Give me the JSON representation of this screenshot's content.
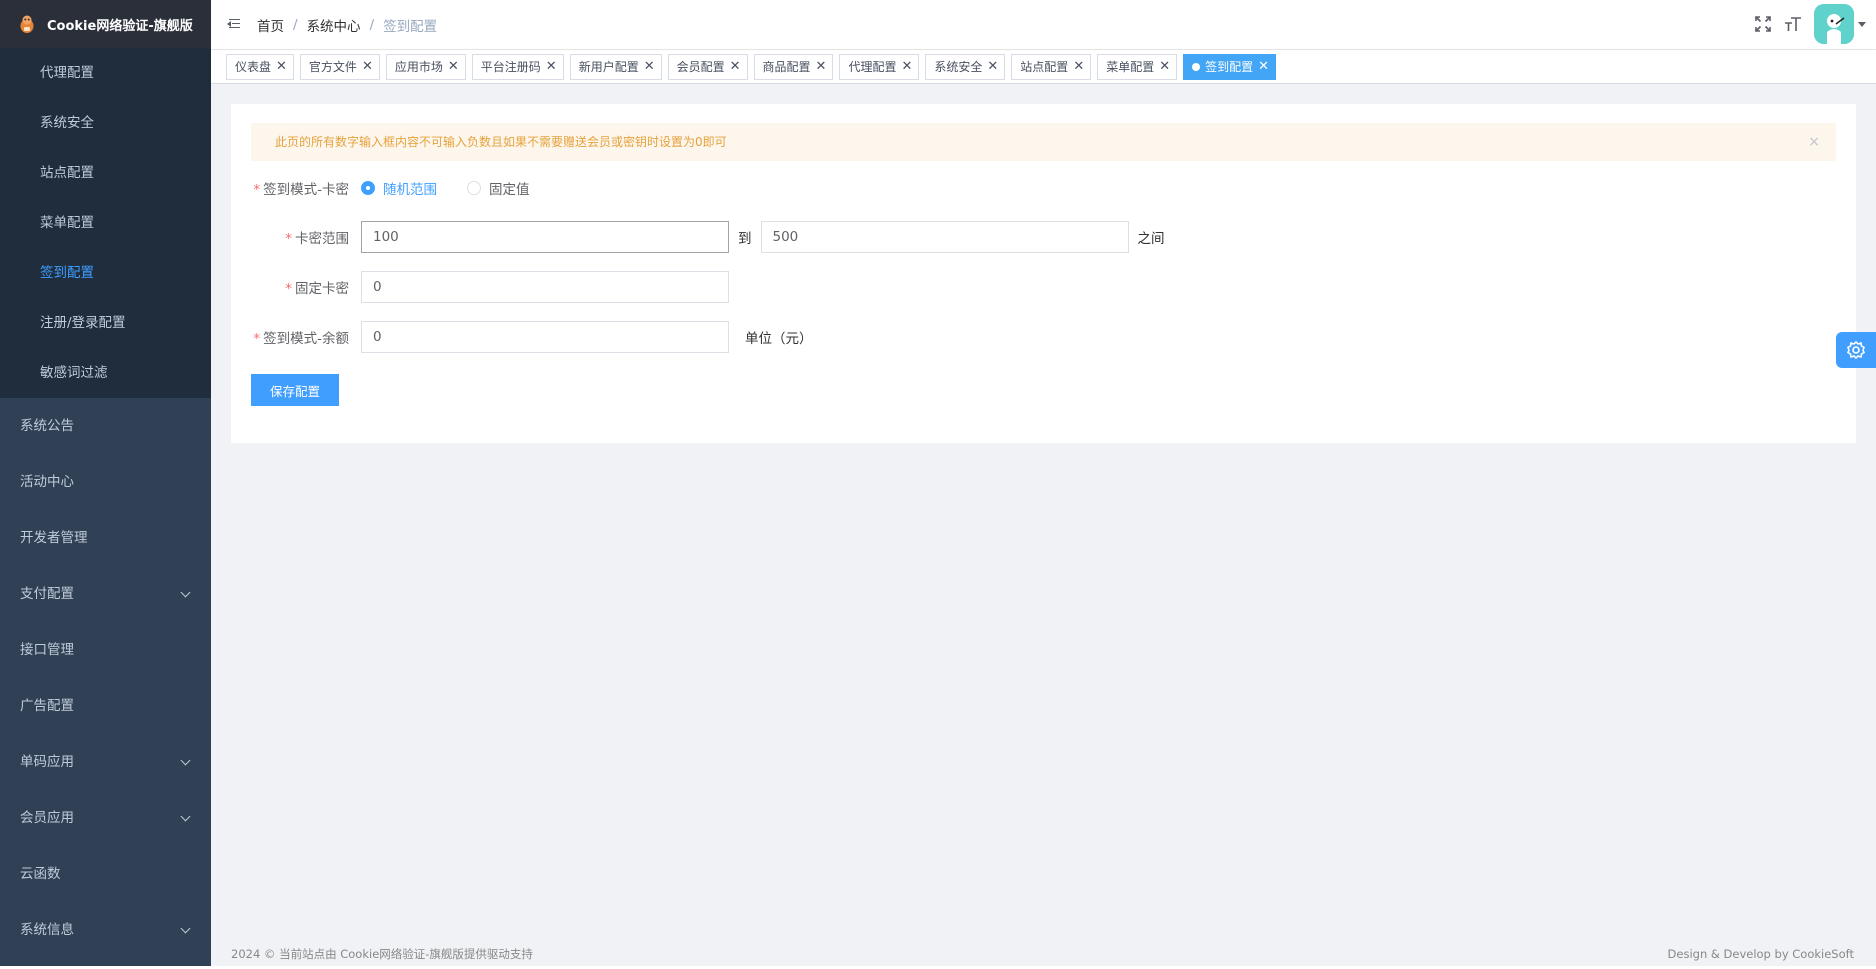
{
  "app": {
    "title": "Cookie网络验证-旗舰版"
  },
  "sidebar": {
    "submenu": [
      {
        "label": "代理配置",
        "active": false
      },
      {
        "label": "系统安全",
        "active": false
      },
      {
        "label": "站点配置",
        "active": false
      },
      {
        "label": "菜单配置",
        "active": false
      },
      {
        "label": "签到配置",
        "active": true
      },
      {
        "label": "注册/登录配置",
        "active": false
      },
      {
        "label": "敏感词过滤",
        "active": false
      }
    ],
    "menu": [
      {
        "label": "系统公告",
        "expandable": false
      },
      {
        "label": "活动中心",
        "expandable": false
      },
      {
        "label": "开发者管理",
        "expandable": false
      },
      {
        "label": "支付配置",
        "expandable": true
      },
      {
        "label": "接口管理",
        "expandable": false
      },
      {
        "label": "广告配置",
        "expandable": false
      },
      {
        "label": "单码应用",
        "expandable": true
      },
      {
        "label": "会员应用",
        "expandable": true
      },
      {
        "label": "云函数",
        "expandable": false
      },
      {
        "label": "系统信息",
        "expandable": true
      }
    ]
  },
  "breadcrumb": {
    "items": [
      "首页",
      "系统中心",
      "签到配置"
    ],
    "separator": "/"
  },
  "tags": [
    {
      "label": "仪表盘",
      "active": false
    },
    {
      "label": "官方文件",
      "active": false
    },
    {
      "label": "应用市场",
      "active": false
    },
    {
      "label": "平台注册码",
      "active": false
    },
    {
      "label": "新用户配置",
      "active": false
    },
    {
      "label": "会员配置",
      "active": false
    },
    {
      "label": "商品配置",
      "active": false
    },
    {
      "label": "代理配置",
      "active": false
    },
    {
      "label": "系统安全",
      "active": false
    },
    {
      "label": "站点配置",
      "active": false
    },
    {
      "label": "菜单配置",
      "active": false
    },
    {
      "label": "签到配置",
      "active": true
    }
  ],
  "alert": {
    "text": "此页的所有数字输入框内容不可输入负数且如果不需要赠送会员或密钥时设置为0即可",
    "close": "×"
  },
  "form": {
    "required_mark": "*",
    "mode_label": "签到模式-卡密",
    "mode_options": [
      {
        "label": "随机范围",
        "checked": true
      },
      {
        "label": "固定值",
        "checked": false
      }
    ],
    "range_label": "卡密范围",
    "range_min": "100",
    "range_to": "到",
    "range_max": "500",
    "range_between": "之间",
    "fixed_label": "固定卡密",
    "fixed_value": "0",
    "balance_label": "签到模式-余额",
    "balance_value": "0",
    "balance_unit": "单位（元）",
    "save_button": "保存配置"
  },
  "footer": {
    "left": "2024 © 当前站点由 Cookie网络验证-旗舰版提供驱动支持",
    "right": "Design & Develop by CookieSoft"
  },
  "colors": {
    "sidebar_bg": "#304156",
    "submenu_bg": "#1f2d3d",
    "accent": "#409eff",
    "alert_bg": "#fdf6ec",
    "alert_text": "#e6a23c",
    "avatar_bg": "#5fd3cb"
  },
  "icons": {
    "logo": "cookie-mascot-icon",
    "hamburger": "fold-menu-icon",
    "fullscreen": "fullscreen-icon",
    "font_size": "font-size-icon",
    "settings": "gear-icon"
  }
}
